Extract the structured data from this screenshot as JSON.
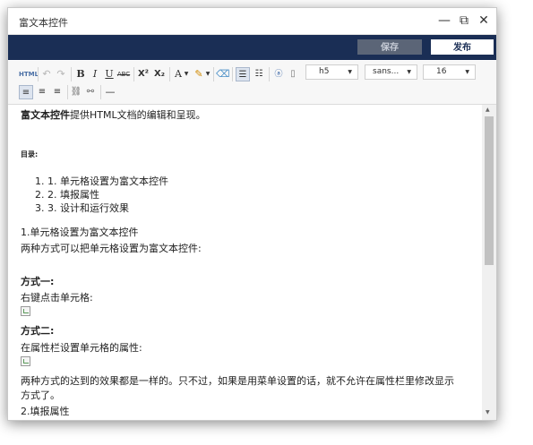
{
  "window": {
    "title": "富文本控件",
    "controls": {
      "minimize": "—",
      "maximize": "⧉",
      "close": "✕"
    }
  },
  "actions": {
    "save_label": "保存",
    "publish_label": "发布"
  },
  "toolbar": {
    "html_label": "HTML",
    "bold": "B",
    "italic": "I",
    "underline": "U",
    "strike": "ABC",
    "superscript": "X²",
    "subscript": "X₂",
    "font_color": "A",
    "paragraph_format": "h5",
    "font_family": "sans...",
    "font_size": "16"
  },
  "content": {
    "intro_bold": "富文本控件",
    "intro_rest": "提供HTML文档的编辑和呈现。",
    "toc_heading": "目录:",
    "toc_items": [
      "1. 单元格设置为富文本控件",
      "2. 填报属性",
      "3. 设计和运行效果"
    ],
    "section1_title": "1.单元格设置为富文本控件",
    "section1_desc": "两种方式可以把单元格设置为富文本控件:",
    "method1_title": "方式一:",
    "method1_desc": "右键点击单元格:",
    "method2_title": "方式二:",
    "method2_desc": "在属性栏设置单元格的属性:",
    "summary_line1": "两种方式的达到的效果都是一样的。只不过，如果是用菜单设置的话，就不允许在属性栏里修改显示",
    "summary_line2": "方式了。",
    "section2_title": "2.填报属性"
  },
  "colors": {
    "action_bar": "#1a2e55",
    "save_disabled": "#5b6577"
  }
}
